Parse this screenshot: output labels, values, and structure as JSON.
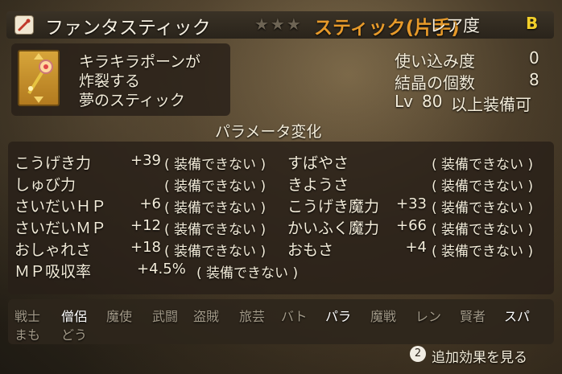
{
  "header": {
    "item_name": "ファンタスティック",
    "stars": "★★★",
    "item_type": "スティック(片手)",
    "rarity_label": "レア度",
    "rarity_value": "B"
  },
  "item": {
    "description": [
      "キラキラポーンが",
      "炸裂する",
      "夢のスティック"
    ]
  },
  "stats": [
    {
      "label": "使い込み度",
      "value": "0"
    },
    {
      "label": "結晶の個数",
      "value": "8"
    },
    {
      "label_prefix": "Lv",
      "level": "80",
      "label_suffix": "以上装備可"
    }
  ],
  "params": {
    "title": "パラメータ変化",
    "left": [
      {
        "name": "こうげき力",
        "value": "+39",
        "note": "装備できない"
      },
      {
        "name": "しゅび力",
        "value": "",
        "note": "装備できない"
      },
      {
        "name": "さいだいＨＰ",
        "value": "+6",
        "note": "装備できない"
      },
      {
        "name": "さいだいＭＰ",
        "value": "+12",
        "note": "装備できない"
      },
      {
        "name": "おしゃれさ",
        "value": "+18",
        "note": "装備できない"
      },
      {
        "name": "ＭＰ吸収率",
        "value": "+4.5%",
        "note": "装備できない"
      }
    ],
    "right": [
      {
        "name": "すばやさ",
        "value": "",
        "note": "装備できない"
      },
      {
        "name": "きようさ",
        "value": "",
        "note": "装備できない"
      },
      {
        "name": "こうげき魔力",
        "value": "+33",
        "note": "装備できない"
      },
      {
        "name": "かいふく魔力",
        "value": "+66",
        "note": "装備できない"
      },
      {
        "name": "おもさ",
        "value": "+4",
        "note": "装備できない"
      }
    ]
  },
  "jobs": {
    "row1": [
      {
        "label": "戦士",
        "on": false
      },
      {
        "label": "僧侶",
        "on": true
      },
      {
        "label": "魔使",
        "on": false
      },
      {
        "label": "武闘",
        "on": false
      },
      {
        "label": "盗賊",
        "on": false
      },
      {
        "label": "旅芸",
        "on": false
      },
      {
        "label": "バト",
        "on": false
      },
      {
        "label": "パラ",
        "on": true
      },
      {
        "label": "魔戦",
        "on": false
      },
      {
        "label": "レン",
        "on": false
      },
      {
        "label": "賢者",
        "on": false
      },
      {
        "label": "スパ",
        "on": true
      }
    ],
    "row2": [
      {
        "label": "まも",
        "on": false
      },
      {
        "label": "どう",
        "on": false
      }
    ]
  },
  "footer": {
    "button_number": "2",
    "more_label": "追加効果を見る"
  },
  "colors": {
    "item_type": "#e79a2a",
    "rarity": "#f2cf2a",
    "job_on": "#ffffff",
    "job_off": "#a39a88"
  }
}
